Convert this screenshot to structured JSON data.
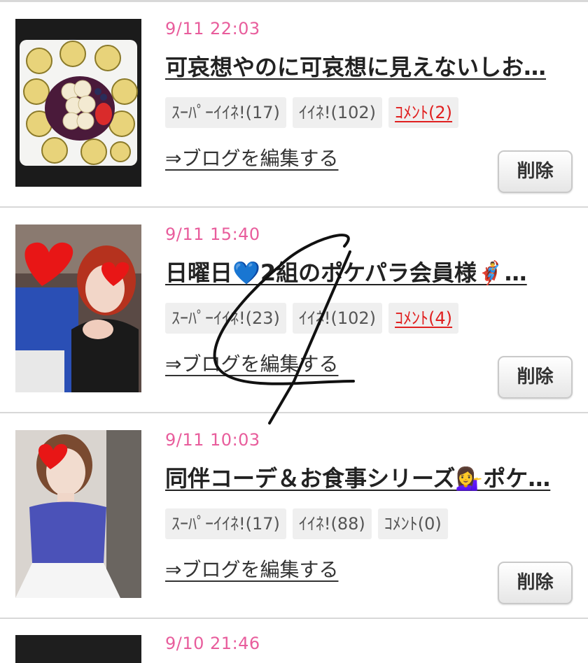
{
  "posts": [
    {
      "date": "9/11 22:03",
      "title": "可哀想やのに可哀想に見えないしお…",
      "super_like": "ｽｰﾊﾟｰｲｲﾈ!(17)",
      "like": "ｲｲﾈ!(102)",
      "comment": "ｺﾒﾝﾄ(2)",
      "edit": "⇒ブログを編集する",
      "delete": "削除"
    },
    {
      "date": "9/11 15:40",
      "title": "日曜日💙2組のポケパラ会員様🦸‍♂️…",
      "super_like": "ｽｰﾊﾟｰｲｲﾈ!(23)",
      "like": "ｲｲﾈ!(102)",
      "comment": "ｺﾒﾝﾄ(4)",
      "edit": "⇒ブログを編集する",
      "delete": "削除"
    },
    {
      "date": "9/11 10:03",
      "title": "同伴コーデ＆お食事シリーズ💁‍♀️ポケ…",
      "super_like": "ｽｰﾊﾟｰｲｲﾈ!(17)",
      "like": "ｲｲﾈ!(88)",
      "comment": "ｺﾒﾝﾄ(0)",
      "edit": "⇒ブログを編集する",
      "delete": "削除"
    },
    {
      "date": "9/10 21:46"
    }
  ],
  "colors": {
    "date_pink": "#e85d9c",
    "comment_red": "#e02020",
    "badge_bg": "#efefef",
    "divider": "#d8d8d8"
  }
}
